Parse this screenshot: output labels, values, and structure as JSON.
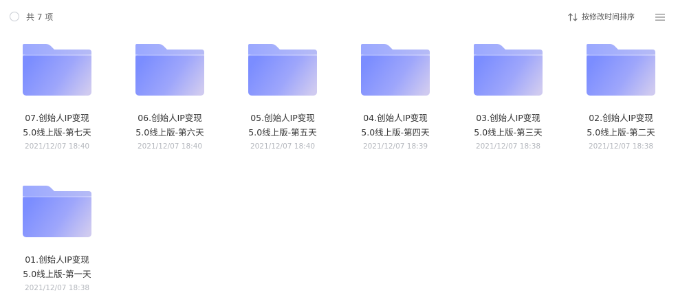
{
  "toolbar": {
    "item_count": "共 7 项",
    "sort_label": "按修改时间排序",
    "sort_icon": "sort-arrows-icon",
    "list_icon": "list-view-icon"
  },
  "colors": {
    "folder_light": "#a9b6ff",
    "folder_main": "#7f91ff",
    "folder_end": "#c9c6f2",
    "date_text": "#b4b7bd"
  },
  "files": [
    {
      "line1": "07.创始人IP变现",
      "line2": "5.0线上版-第七天",
      "date": "2021/12/07 18:40",
      "icon": "folder-icon"
    },
    {
      "line1": "06.创始人IP变现",
      "line2": "5.0线上版-第六天",
      "date": "2021/12/07 18:40",
      "icon": "folder-icon"
    },
    {
      "line1": "05.创始人IP变现",
      "line2": "5.0线上版-第五天",
      "date": "2021/12/07 18:40",
      "icon": "folder-icon"
    },
    {
      "line1": "04.创始人IP变现",
      "line2": "5.0线上版-第四天",
      "date": "2021/12/07 18:39",
      "icon": "folder-icon"
    },
    {
      "line1": "03.创始人IP变现",
      "line2": "5.0线上版-第三天",
      "date": "2021/12/07 18:38",
      "icon": "folder-icon"
    },
    {
      "line1": "02.创始人IP变现",
      "line2": "5.0线上版-第二天",
      "date": "2021/12/07 18:38",
      "icon": "folder-icon"
    },
    {
      "line1": "01.创始人IP变现",
      "line2": "5.0线上版-第一天",
      "date": "2021/12/07 18:38",
      "icon": "folder-icon"
    }
  ]
}
